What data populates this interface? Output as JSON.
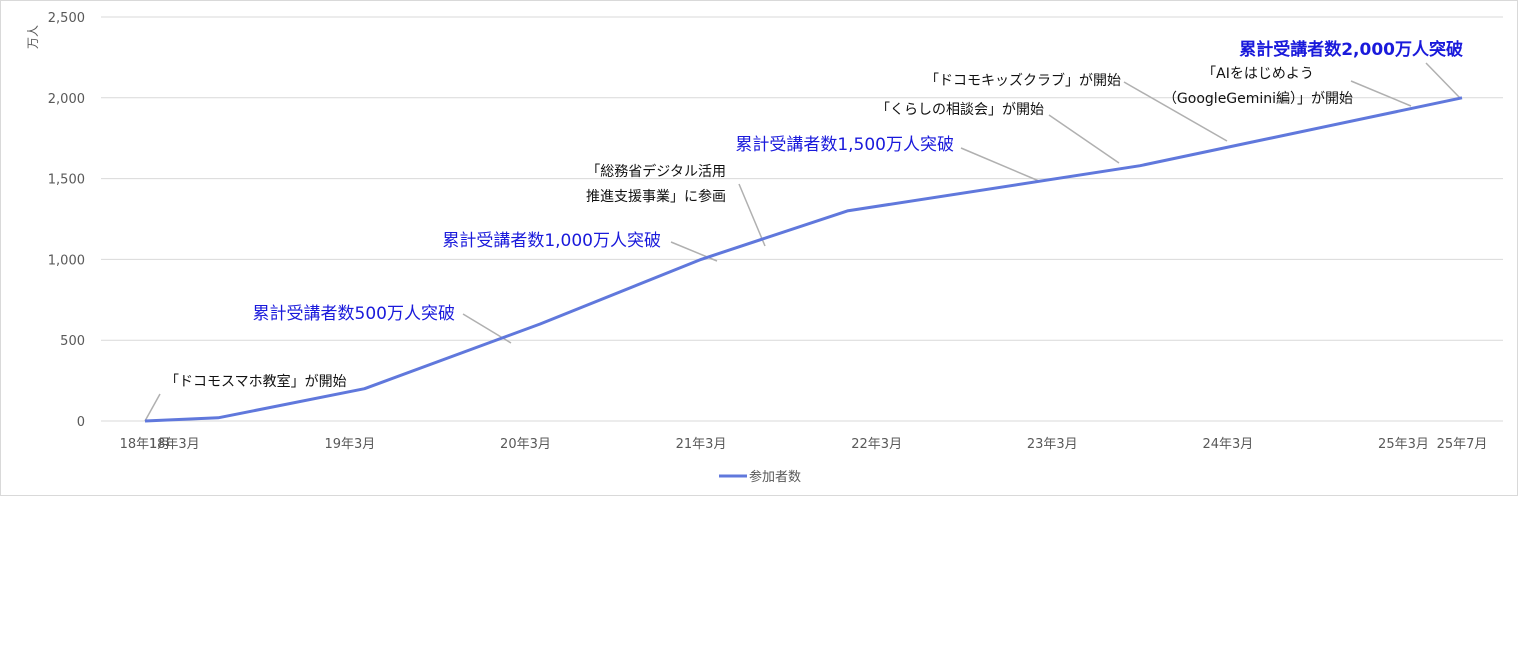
{
  "chart_data": {
    "type": "line",
    "unit_label": "万人",
    "y_ticks": [
      "0",
      "500",
      "1,000",
      "1,500",
      "2,000",
      "2,500"
    ],
    "y_tick_values": [
      0,
      500,
      1000,
      1500,
      2000,
      2500
    ],
    "ylim": [
      0,
      2500
    ],
    "grid": true,
    "legend_position": "bottom",
    "x_labels": [
      "18年1月",
      "18年3月",
      "19年3月",
      "20年3月",
      "21年3月",
      "22年3月",
      "23年3月",
      "24年3月",
      "25年3月",
      "25年7月"
    ],
    "x_month_index": [
      0,
      2,
      14,
      26,
      38,
      50,
      62,
      74,
      86,
      90
    ],
    "series": [
      {
        "name": "参加者数",
        "color": "#6078dc",
        "points": [
          {
            "x": 0,
            "y": 0
          },
          {
            "x": 5,
            "y": 20
          },
          {
            "x": 15,
            "y": 200
          },
          {
            "x": 27,
            "y": 600
          },
          {
            "x": 38,
            "y": 1000
          },
          {
            "x": 48,
            "y": 1300
          },
          {
            "x": 68,
            "y": 1580
          },
          {
            "x": 90,
            "y": 2000
          }
        ]
      }
    ],
    "annotations": [
      {
        "id": "a1",
        "lines": [
          "「ドコモスマホ教室」が開始"
        ],
        "style": "black"
      },
      {
        "id": "a2",
        "lines": [
          "累計受講者数500万人突破"
        ],
        "style": "blue"
      },
      {
        "id": "a3",
        "lines": [
          "累計受講者数1,000万人突破"
        ],
        "style": "blue"
      },
      {
        "id": "a4",
        "lines": [
          "「総務省デジタル活用",
          "推進支援事業」に参画"
        ],
        "style": "black"
      },
      {
        "id": "a5",
        "lines": [
          "累計受講者数1,500万人突破"
        ],
        "style": "blue"
      },
      {
        "id": "a6",
        "lines": [
          "「くらしの相談会」が開始"
        ],
        "style": "black"
      },
      {
        "id": "a7",
        "lines": [
          "「ドコモキッズクラブ」が開始"
        ],
        "style": "black"
      },
      {
        "id": "a8",
        "lines": [
          "「AIをはじめよう",
          "（GoogleGemini編）」が開始"
        ],
        "style": "black"
      },
      {
        "id": "a9",
        "lines": [
          "累計受講者数2,000万人突破"
        ],
        "style": "blue-bold"
      }
    ]
  }
}
